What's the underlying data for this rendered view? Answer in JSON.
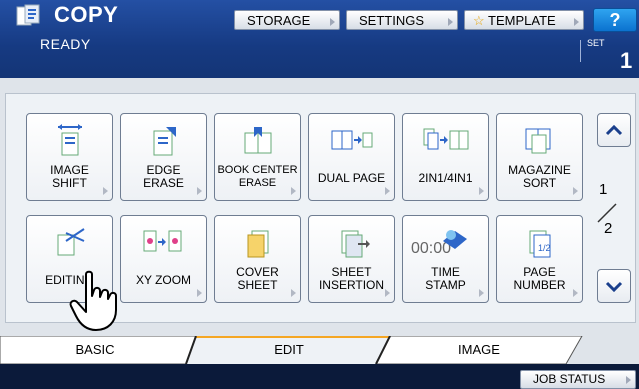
{
  "header": {
    "title": "COPY",
    "status": "READY",
    "buttons": [
      {
        "label": "STORAGE"
      },
      {
        "label": "SETTINGS"
      },
      {
        "label": "TEMPLATE"
      }
    ],
    "help_label": "?",
    "set_label": "SET",
    "set_value": "1"
  },
  "functions": [
    {
      "label": "IMAGE\nSHIFT",
      "icon": "image-shift-icon"
    },
    {
      "label": "EDGE\nERASE",
      "icon": "edge-erase-icon"
    },
    {
      "label": "BOOK CENTER\nERASE",
      "icon": "book-center-erase-icon"
    },
    {
      "label": "DUAL PAGE",
      "icon": "dual-page-icon"
    },
    {
      "label": "2IN1/4IN1",
      "icon": "2in1-4in1-icon"
    },
    {
      "label": "MAGAZINE\nSORT",
      "icon": "magazine-sort-icon"
    },
    {
      "label": "EDITING",
      "icon": "editing-icon"
    },
    {
      "label": "XY ZOOM",
      "icon": "xy-zoom-icon"
    },
    {
      "label": "COVER\nSHEET",
      "icon": "cover-sheet-icon"
    },
    {
      "label": "SHEET\nINSERTION",
      "icon": "sheet-insertion-icon"
    },
    {
      "label": "TIME\nSTAMP",
      "icon": "time-stamp-icon",
      "icon_text": "00:00"
    },
    {
      "label": "PAGE\nNUMBER",
      "icon": "page-number-icon"
    }
  ],
  "pager": {
    "current": "1",
    "total": "2"
  },
  "tabs": [
    {
      "label": "BASIC"
    },
    {
      "label": "EDIT",
      "active": true
    },
    {
      "label": "IMAGE"
    }
  ],
  "footer": {
    "job_status": "JOB STATUS"
  },
  "colors": {
    "header_blue": "#163a82",
    "active_tab_accent": "#f5a623",
    "bottom_bar": "#0b1a3a"
  }
}
